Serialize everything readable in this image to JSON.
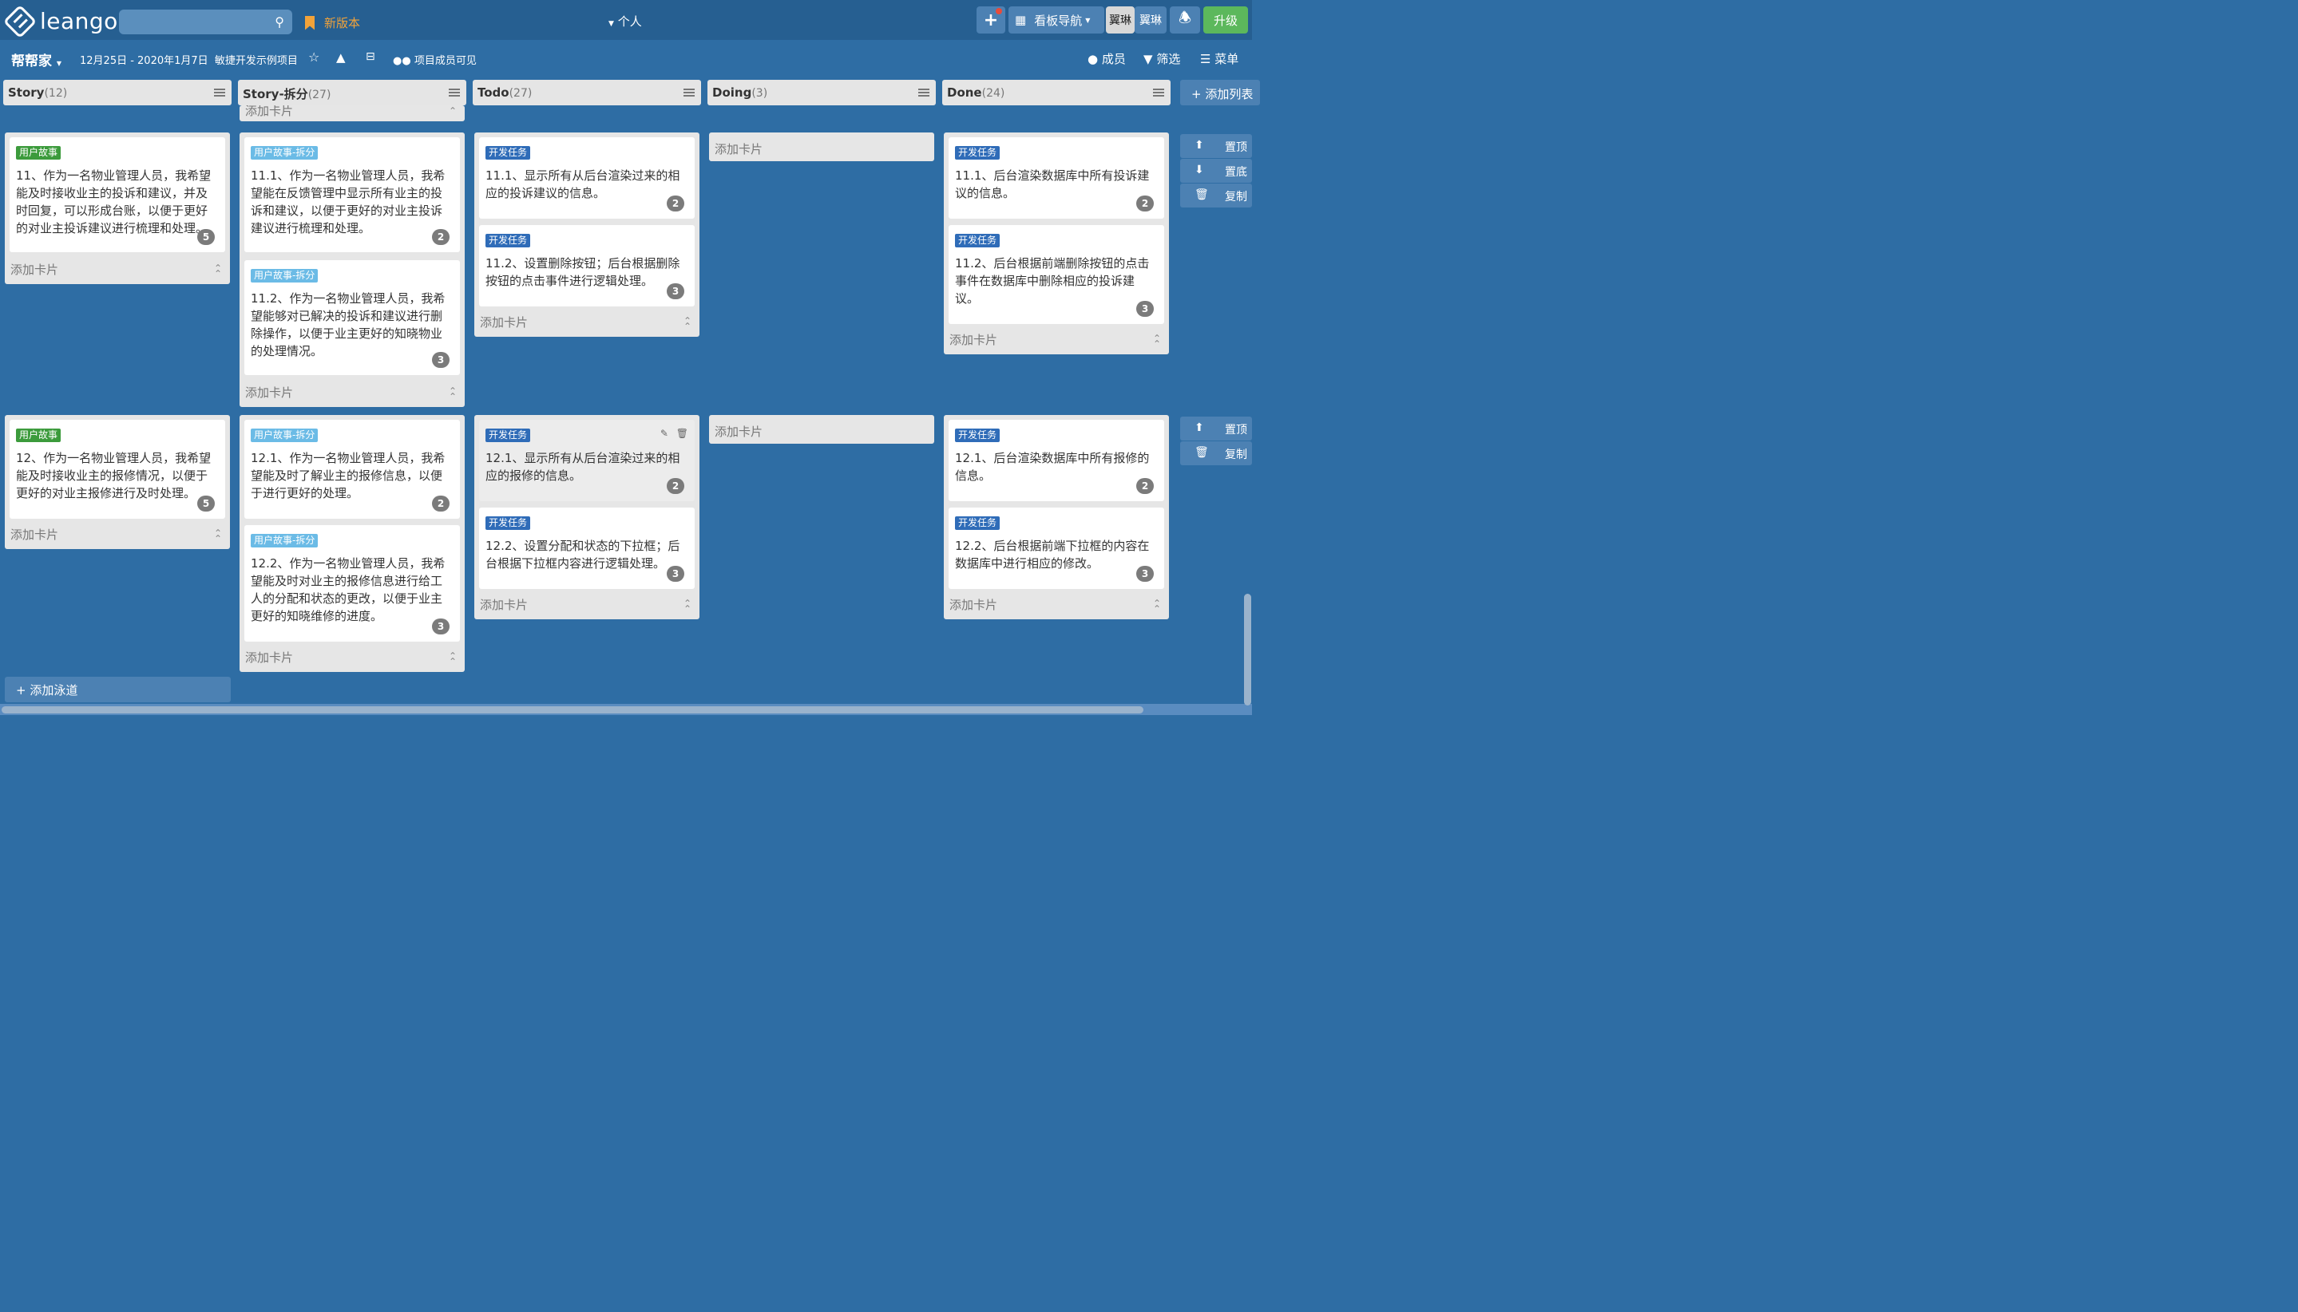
{
  "app": {
    "logo": "leangoo",
    "new_version": "新版本",
    "personal_menu": "个人"
  },
  "search": {
    "placeholder": ""
  },
  "header": {
    "add": "+",
    "board_nav": "看板导航",
    "user1": "翼琳",
    "user2": "翼琳",
    "upgrade": "升级"
  },
  "board": {
    "name": "帮帮家",
    "sprint": "12月25日 - 2020年1月7日",
    "project": "敏捷开发示例项目",
    "visibility": "项目成员可见",
    "members": "成员",
    "filter": "筛选",
    "menu": "菜单"
  },
  "lists": [
    {
      "title": "Story",
      "count": "(12)"
    },
    {
      "title": "Story-拆分",
      "count": "(27)"
    },
    {
      "title": "Todo",
      "count": "(27)"
    },
    {
      "title": "Doing",
      "count": "(3)"
    },
    {
      "title": "Done",
      "count": "(24)"
    }
  ],
  "add_list": "添加列表",
  "add_card": "添加卡片",
  "add_lane": "添加泳道",
  "side_tools": {
    "top": "置顶",
    "bottom": "置底",
    "copy": "复制"
  },
  "tags": {
    "story": "用户故事",
    "split": "用户故事-拆分",
    "dev": "开发任务"
  },
  "lane1": {
    "story": [
      {
        "text": "11、作为一名物业管理人员，我希望能及时接收业主的投诉和建议，并及时回复，可以形成台账，以便于更好的对业主投诉建议进行梳理和处理。",
        "badge": "5"
      }
    ],
    "split": [
      {
        "text": "11.1、作为一名物业管理人员，我希望能在反馈管理中显示所有业主的投诉和建议，以便于更好的对业主投诉建议进行梳理和处理。",
        "badge": "2"
      },
      {
        "text": "11.2、作为一名物业管理人员，我希望能够对已解决的投诉和建议进行删除操作，以便于业主更好的知晓物业的处理情况。",
        "badge": "3"
      }
    ],
    "todo": [
      {
        "text": "11.1、显示所有从后台渲染过来的相应的投诉建议的信息。",
        "badge": "2"
      },
      {
        "text": "11.2、设置删除按钮；后台根据删除按钮的点击事件进行逻辑处理。",
        "badge": "3"
      }
    ],
    "done": [
      {
        "text": "11.1、后台渲染数据库中所有投诉建议的信息。",
        "badge": "2"
      },
      {
        "text": "11.2、后台根据前端删除按钮的点击事件在数据库中删除相应的投诉建议。",
        "badge": "3"
      }
    ]
  },
  "lane2": {
    "story": [
      {
        "text": "12、作为一名物业管理人员，我希望能及时接收业主的报修情况，以便于更好的对业主报修进行及时处理。",
        "badge": "5"
      }
    ],
    "split": [
      {
        "text": "12.1、作为一名物业管理人员，我希望能及时了解业主的报修信息，以便于进行更好的处理。",
        "badge": "2"
      },
      {
        "text": "12.2、作为一名物业管理人员，我希望能及时对业主的报修信息进行给工人的分配和状态的更改，以便于业主更好的知晓维修的进度。",
        "badge": "3"
      }
    ],
    "todo": [
      {
        "text": "12.1、显示所有从后台渲染过来的相应的报修的信息。",
        "badge": "2"
      },
      {
        "text": "12.2、设置分配和状态的下拉框；后台根据下拉框内容进行逻辑处理。",
        "badge": "3"
      }
    ],
    "done": [
      {
        "text": "12.1、后台渲染数据库中所有报修的信息。",
        "badge": "2"
      },
      {
        "text": "12.2、后台根据前端下拉框的内容在数据库中进行相应的修改。",
        "badge": "3"
      }
    ]
  }
}
